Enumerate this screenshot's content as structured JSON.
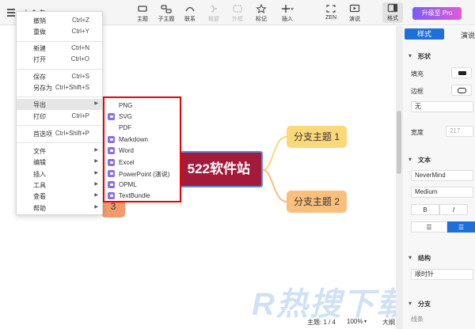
{
  "app": {
    "doc_title": "未命名"
  },
  "toolbar": {
    "items": [
      {
        "label": "主题",
        "icon": "topic-icon"
      },
      {
        "label": "子主题",
        "icon": "subtopic-icon"
      },
      {
        "label": "联系",
        "icon": "relationship-icon"
      },
      {
        "label": "概要",
        "icon": "summary-icon"
      },
      {
        "label": "外框",
        "icon": "boundary-icon"
      },
      {
        "label": "标记",
        "icon": "star-icon"
      },
      {
        "label": "插入",
        "icon": "plus-icon"
      },
      {
        "label": "ZEN",
        "icon": "zen-icon"
      },
      {
        "label": "演说",
        "icon": "pitch-icon"
      },
      {
        "label": "格式",
        "icon": "format-icon"
      }
    ],
    "upgrade_label": "升级至 Pro"
  },
  "menu": {
    "items": [
      {
        "label": "撤销",
        "shortcut": "Ctrl+Z"
      },
      {
        "label": "重做",
        "shortcut": "Ctrl+Y"
      },
      {
        "label": "新建",
        "shortcut": "Ctrl+N"
      },
      {
        "label": "打开",
        "shortcut": "Ctrl+O"
      },
      {
        "label": "保存",
        "shortcut": "Ctrl+S"
      },
      {
        "label": "另存为",
        "shortcut": "Ctrl+Shift+S"
      },
      {
        "label": "导出",
        "shortcut": ""
      },
      {
        "label": "打印",
        "shortcut": "Ctrl+P"
      },
      {
        "label": "首选项",
        "shortcut": "Ctrl+Shift+P"
      },
      {
        "label": "文件",
        "shortcut": ""
      },
      {
        "label": "编辑",
        "shortcut": ""
      },
      {
        "label": "插入",
        "shortcut": ""
      },
      {
        "label": "工具",
        "shortcut": ""
      },
      {
        "label": "查看",
        "shortcut": ""
      },
      {
        "label": "帮助",
        "shortcut": ""
      }
    ]
  },
  "export_menu": {
    "items": [
      {
        "label": "PNG",
        "pro": false
      },
      {
        "label": "SVG",
        "pro": true
      },
      {
        "label": "PDF",
        "pro": false
      },
      {
        "label": "Markdown",
        "pro": true
      },
      {
        "label": "Word",
        "pro": true
      },
      {
        "label": "Excel",
        "pro": true
      },
      {
        "label": "PowerPoint (演说)",
        "pro": true
      },
      {
        "label": "OPML",
        "pro": true
      },
      {
        "label": "TextBundle",
        "pro": true
      }
    ]
  },
  "canvas": {
    "central_topic": "522软件站",
    "branch_1": "分支主题 1",
    "branch_2": "分支主题 2",
    "branch_3": "3",
    "watermark": "R热搜下载"
  },
  "status": {
    "topics": "主题: 1 / 4",
    "zoom": "100%",
    "outline": "大纲"
  },
  "panel": {
    "tab_style": "样式",
    "tab_map": "演说",
    "section_shape": "形状",
    "fill_label": "填充",
    "border_label": "边框",
    "border_value": "无",
    "width_label": "宽度",
    "width_value": "217",
    "section_text": "文本",
    "font_name": "NeverMind",
    "font_weight": "Medium",
    "bold": "B",
    "italic": "I",
    "section_structure": "结构",
    "structure_value": "顺时针",
    "section_branch": "分支",
    "branch_sub": "线条"
  },
  "colors": {
    "accent": "#1e6fd9",
    "central_topic": "#a21b3b",
    "branch_1": "#fbd87a",
    "branch_2": "#fbbf7c",
    "highlight_border": "#e00000",
    "pro_badge": "#8a6fe6"
  }
}
